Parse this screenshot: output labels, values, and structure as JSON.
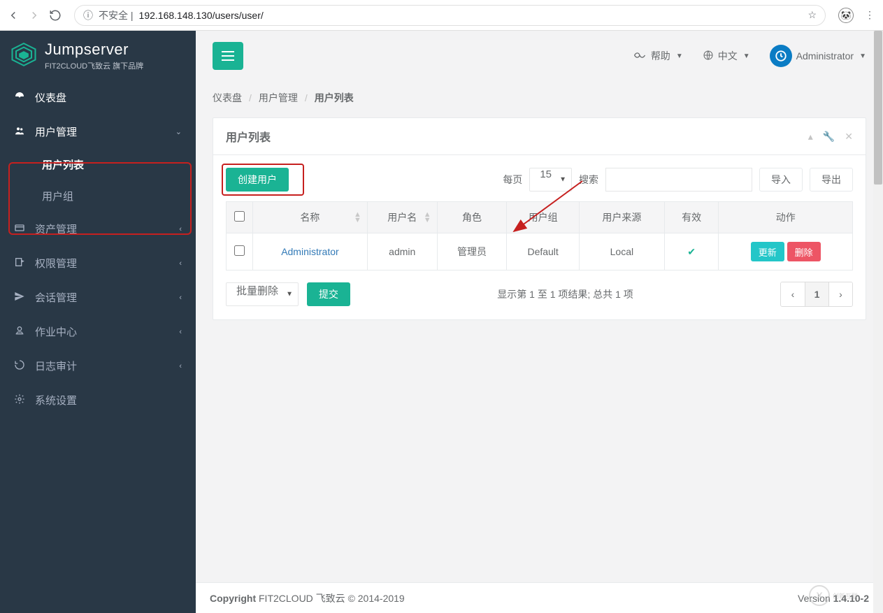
{
  "browser": {
    "url_prefix": "不安全 | ",
    "url": "192.168.148.130/users/user/"
  },
  "brand": {
    "name": "Jumpserver",
    "sub": "FIT2CLOUD飞致云 旗下品牌"
  },
  "sidebar": {
    "dashboard": "仪表盘",
    "user_mgmt": "用户管理",
    "user_list": "用户列表",
    "user_group": "用户组",
    "assets": "资产管理",
    "perms": "权限管理",
    "sessions": "会话管理",
    "jobs": "作业中心",
    "audits": "日志审计",
    "settings": "系统设置"
  },
  "topbar": {
    "help": "帮助",
    "lang": "中文",
    "user": "Administrator"
  },
  "breadcrumb": {
    "a": "仪表盘",
    "b": "用户管理",
    "c": "用户列表"
  },
  "panel": {
    "title": "用户列表"
  },
  "toolbar": {
    "create": "创建用户",
    "per_page_label": "每页",
    "per_page_value": "15",
    "search_label": "搜索",
    "import": "导入",
    "export": "导出"
  },
  "columns": {
    "name": "名称",
    "username": "用户名",
    "role": "角色",
    "group": "用户组",
    "source": "用户来源",
    "valid": "有效",
    "action": "动作"
  },
  "rows": [
    {
      "name": "Administrator",
      "username": "admin",
      "role": "管理员",
      "group": "Default",
      "source": "Local"
    }
  ],
  "row_actions": {
    "update": "更新",
    "delete": "删除"
  },
  "batch": {
    "select": "批量删除",
    "submit": "提交"
  },
  "table_info": "显示第 1 至 1 项结果; 总共 1 项",
  "pagination": {
    "current": "1"
  },
  "footer": {
    "copyright_label": "Copyright",
    "copyright_rest": " FIT2CLOUD 飞致云 © 2014-2019",
    "version_label": "Version ",
    "version": "1.4.10-2"
  },
  "watermark": "创新互联"
}
